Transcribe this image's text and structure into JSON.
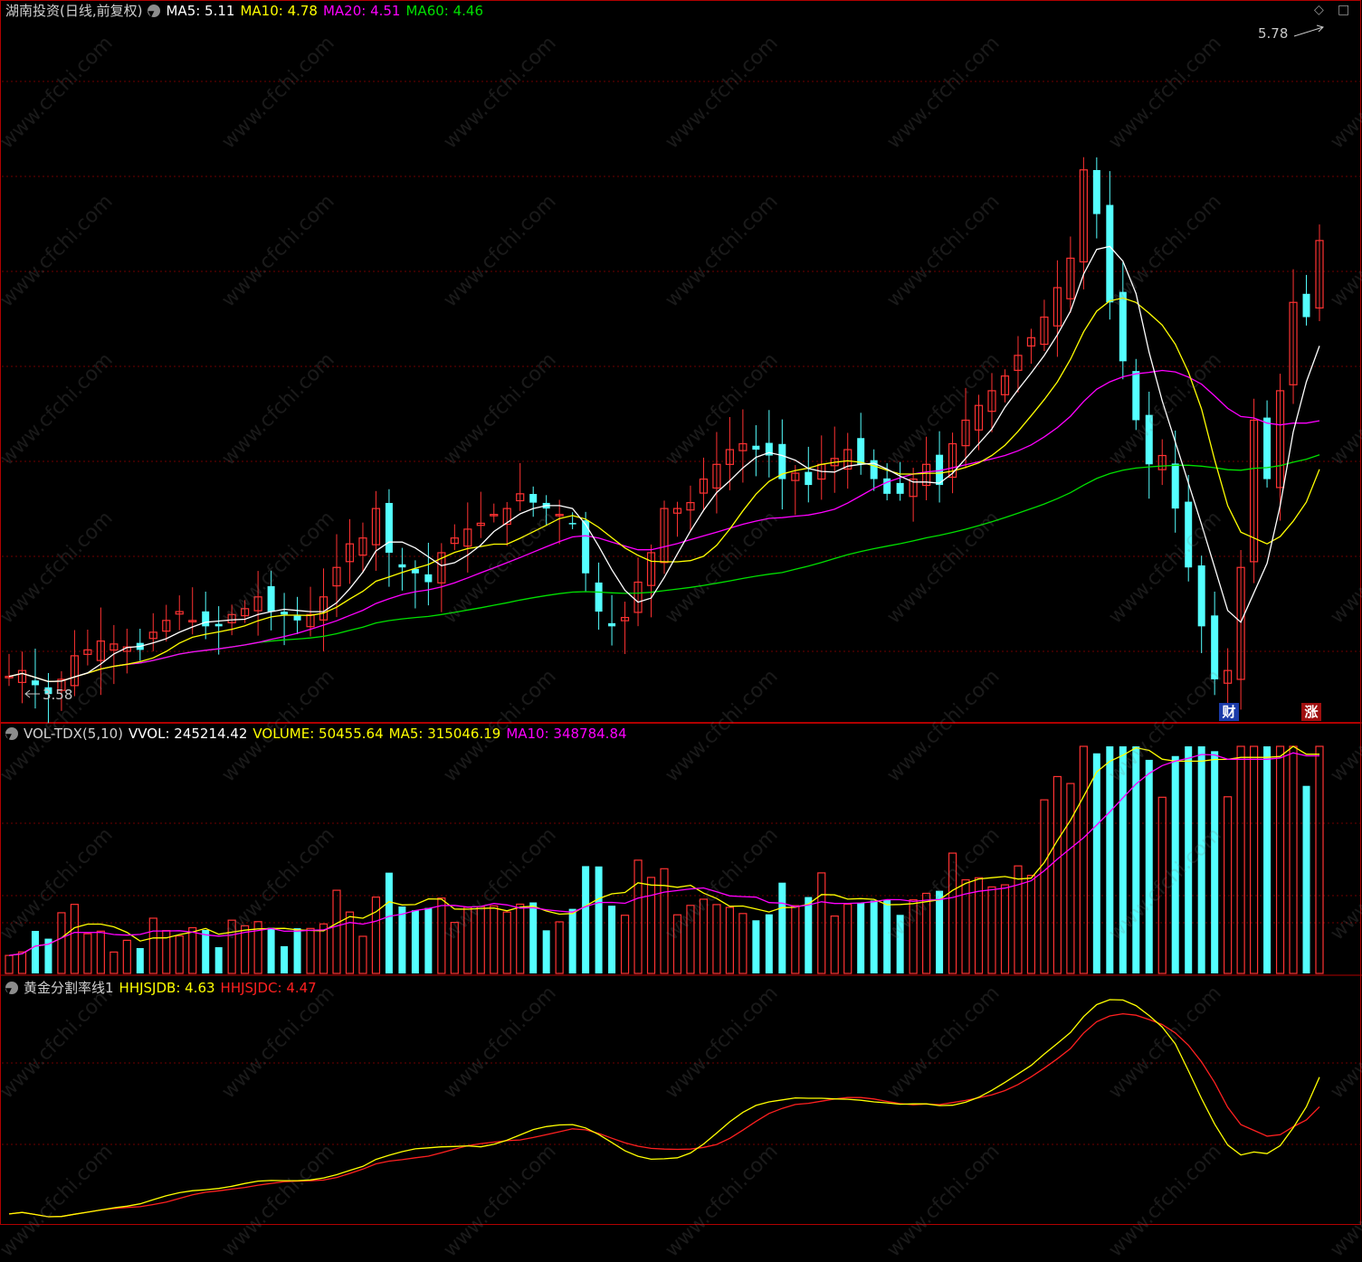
{
  "price_panel": {
    "title": "湖南投资(日线,前复权)",
    "ma5_label": "MA5: 5.11",
    "ma10_label": "MA10: 4.78",
    "ma20_label": "MA20: 4.51",
    "ma60_label": "MA60: 4.46",
    "high_marker": "5.78",
    "low_marker": "3.58",
    "badge_cai": "财",
    "badge_zhang": "涨"
  },
  "volume_panel": {
    "name_label": "VOL-TDX(5,10)",
    "vvol_label": "VVOL: 245214.42",
    "volume_label": "VOLUME: 50455.64",
    "ma5_label": "MA5: 315046.19",
    "ma10_label": "MA10: 348784.84"
  },
  "indicator_panel": {
    "name_label": "黄金分割率线1",
    "hhjsjdb_label": "HHJSJDB: 4.63",
    "hhjsjdc_label": "HHJSJDC: 4.47"
  },
  "watermark": "www.cfchi.com",
  "colors": {
    "background": "#000000",
    "up_candle": "#ff3232",
    "down_candle": "#54ffff",
    "ma5": "#ffffff",
    "ma10": "#ffff00",
    "ma20": "#ff00ff",
    "ma60": "#00e000",
    "panel_border": "#b00000",
    "grid": "#6e0000",
    "hhjsjdb": "#ffff00",
    "hhjsjdc": "#ff2020"
  },
  "chart_data": {
    "type": "candlestick",
    "ylim": [
      3.5,
      5.85
    ],
    "series_close_approx": [
      3.63,
      3.65,
      3.6,
      3.57,
      3.62,
      3.7,
      3.72,
      3.75,
      3.74,
      3.73,
      3.72,
      3.78,
      3.82,
      3.85,
      3.82,
      3.8,
      3.8,
      3.84,
      3.86,
      3.9,
      3.85,
      3.84,
      3.82,
      3.84,
      3.9,
      4.0,
      4.08,
      4.1,
      4.2,
      4.05,
      4.0,
      3.98,
      3.95,
      4.05,
      4.1,
      4.13,
      4.15,
      4.18,
      4.2,
      4.25,
      4.22,
      4.2,
      4.18,
      4.15,
      3.98,
      3.85,
      3.8,
      3.83,
      3.95,
      4.05,
      4.2,
      4.2,
      4.22,
      4.3,
      4.35,
      4.4,
      4.42,
      4.4,
      4.38,
      4.3,
      4.32,
      4.28,
      4.35,
      4.37,
      4.4,
      4.35,
      4.3,
      4.25,
      4.25,
      4.3,
      4.35,
      4.28,
      4.42,
      4.5,
      4.55,
      4.6,
      4.65,
      4.72,
      4.78,
      4.85,
      4.95,
      5.05,
      5.35,
      5.2,
      4.9,
      4.7,
      4.5,
      4.35,
      4.38,
      4.2,
      4.0,
      3.8,
      3.62,
      3.65,
      4.0,
      4.5,
      4.3,
      4.6,
      4.9,
      4.85,
      5.11
    ]
  }
}
